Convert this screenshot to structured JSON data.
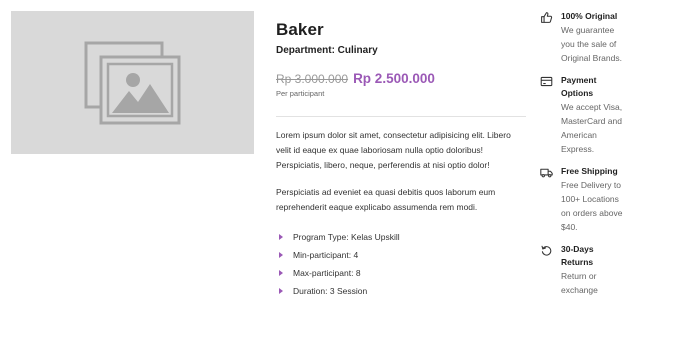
{
  "product": {
    "title": "Baker",
    "department": "Department: Culinary",
    "price_old": "Rp 3.000.000",
    "price_new": "Rp 2.500.000",
    "price_note": "Per participant",
    "description": [
      "Lorem ipsum dolor sit amet, consectetur adipisicing elit. Libero velit id eaque ex quae laboriosam nulla optio doloribus! Perspiciatis, libero, neque, perferendis at nisi optio dolor!",
      "Perspiciatis ad eveniet ea quasi debitis quos laborum eum reprehenderit eaque explicabo assumenda rem modi."
    ],
    "specs": [
      "Program Type: Kelas Upskill",
      "Min-participant: 4",
      "Max-participant: 8",
      "Duration: 3 Session"
    ],
    "image_icon": "image-placeholder-icon"
  },
  "features": [
    {
      "icon": "thumbs-up-icon",
      "title": "100% Original",
      "desc": "We guarantee you the sale of Original Brands."
    },
    {
      "icon": "credit-card-icon",
      "title": "Payment Options",
      "desc": "We accept Visa, MasterCard and American Express."
    },
    {
      "icon": "truck-icon",
      "title": "Free Shipping",
      "desc": "Free Delivery to 100+ Locations on orders above $40."
    },
    {
      "icon": "return-icon",
      "title": "30-Days Returns",
      "desc": "Return or exchange"
    }
  ],
  "colors": {
    "accent": "#9b59b6",
    "placeholder_bg": "#d9d9d9",
    "placeholder_fg": "#a6a6a6"
  }
}
